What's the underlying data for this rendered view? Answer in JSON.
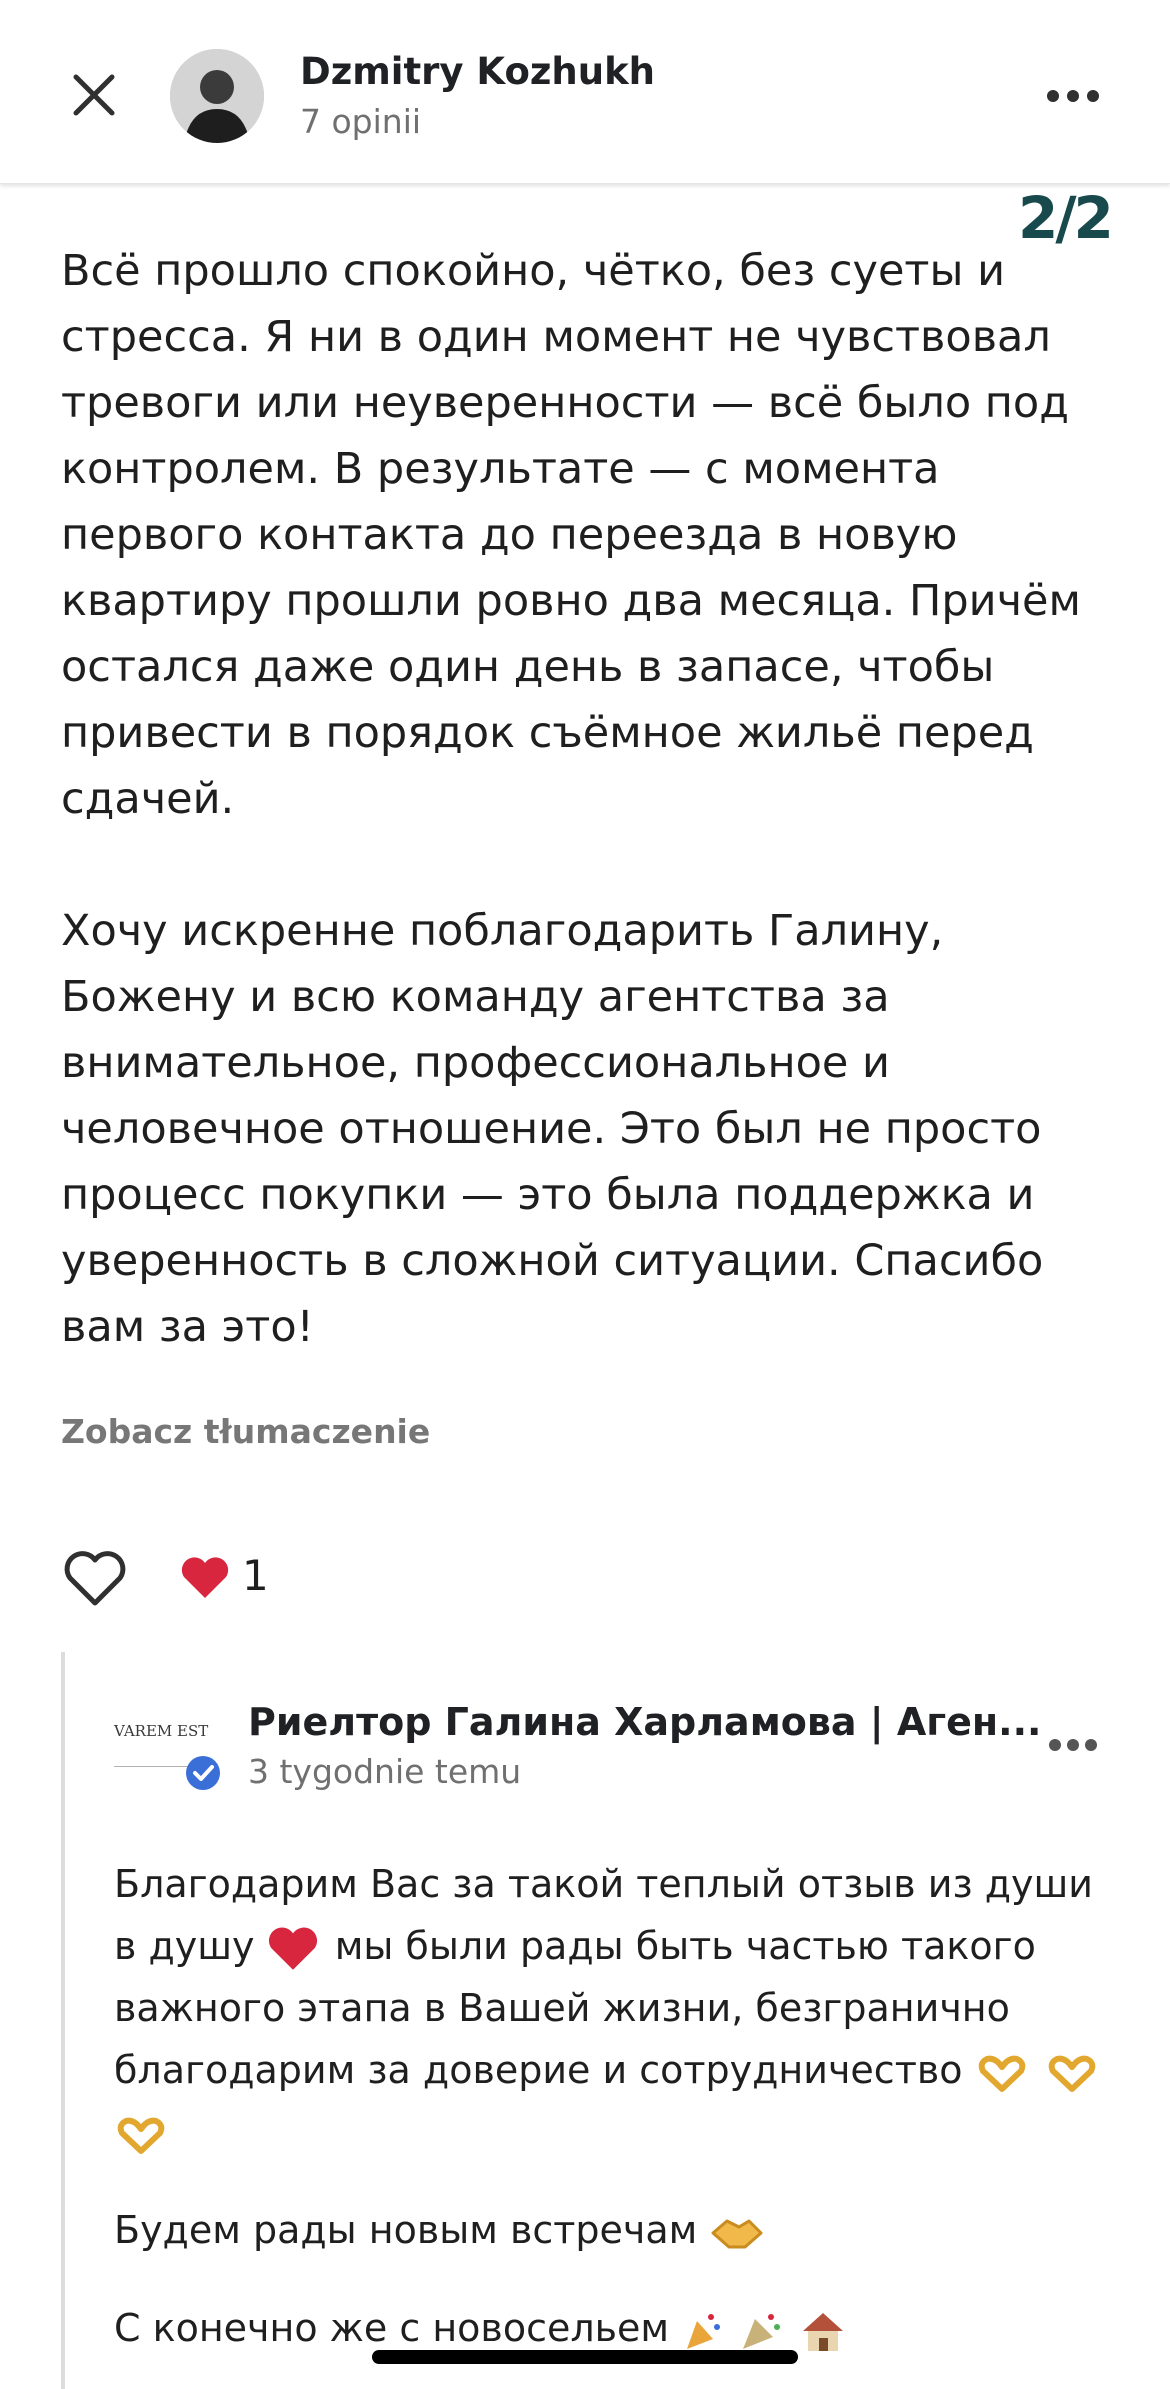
{
  "header": {
    "author_name": "Dzmitry Kozhukh",
    "author_sub": "7 opinii",
    "close_icon": "close-icon",
    "more_icon": "more-horizontal-icon"
  },
  "page_counter": "2/2",
  "review": {
    "paragraphs": [
      "Всё прошло спокойно, чётко, без суеты и стресса. Я ни в один момент не чувствовал тревоги или неуверенности — всё было под контролем. В результате — с момента первого контакта до переезда в новую квартиру прошли ровно два месяца. Причём остался даже один день в запасе, чтобы привести в порядок съёмное жильё перед сдачей.",
      "Хочу искренне поблагодарить Галину, Божену и всю команду агентства за внимательное, профессиональное и человечное отношение. Это был не просто процесс покупки — это была поддержка и уверенность в сложной ситуации. Спасибо вам за это!"
    ],
    "translate_label": "Zobacz tłumaczenie",
    "likes_count": "1"
  },
  "reply": {
    "logo_text": "VAREM EST",
    "owner_name": "Риелтор Галина Харламова | Аген...",
    "time": "3 tygodnie temu",
    "paragraph1_a": "Благодарим Вас за такой теплый отзыв из души в душу",
    "paragraph1_b": "мы были рады быть частью такого важного этапа в Вашей жизни, безгранично благодарим за доверие и сотрудничество",
    "paragraph2": "Будем рады новым встречам",
    "paragraph3": "С конечно же с новосельем"
  },
  "colors": {
    "accent_counter": "#17494d",
    "heart_red": "#d7263d",
    "verified_blue": "#3b6fd8",
    "muted_text": "#707070"
  }
}
